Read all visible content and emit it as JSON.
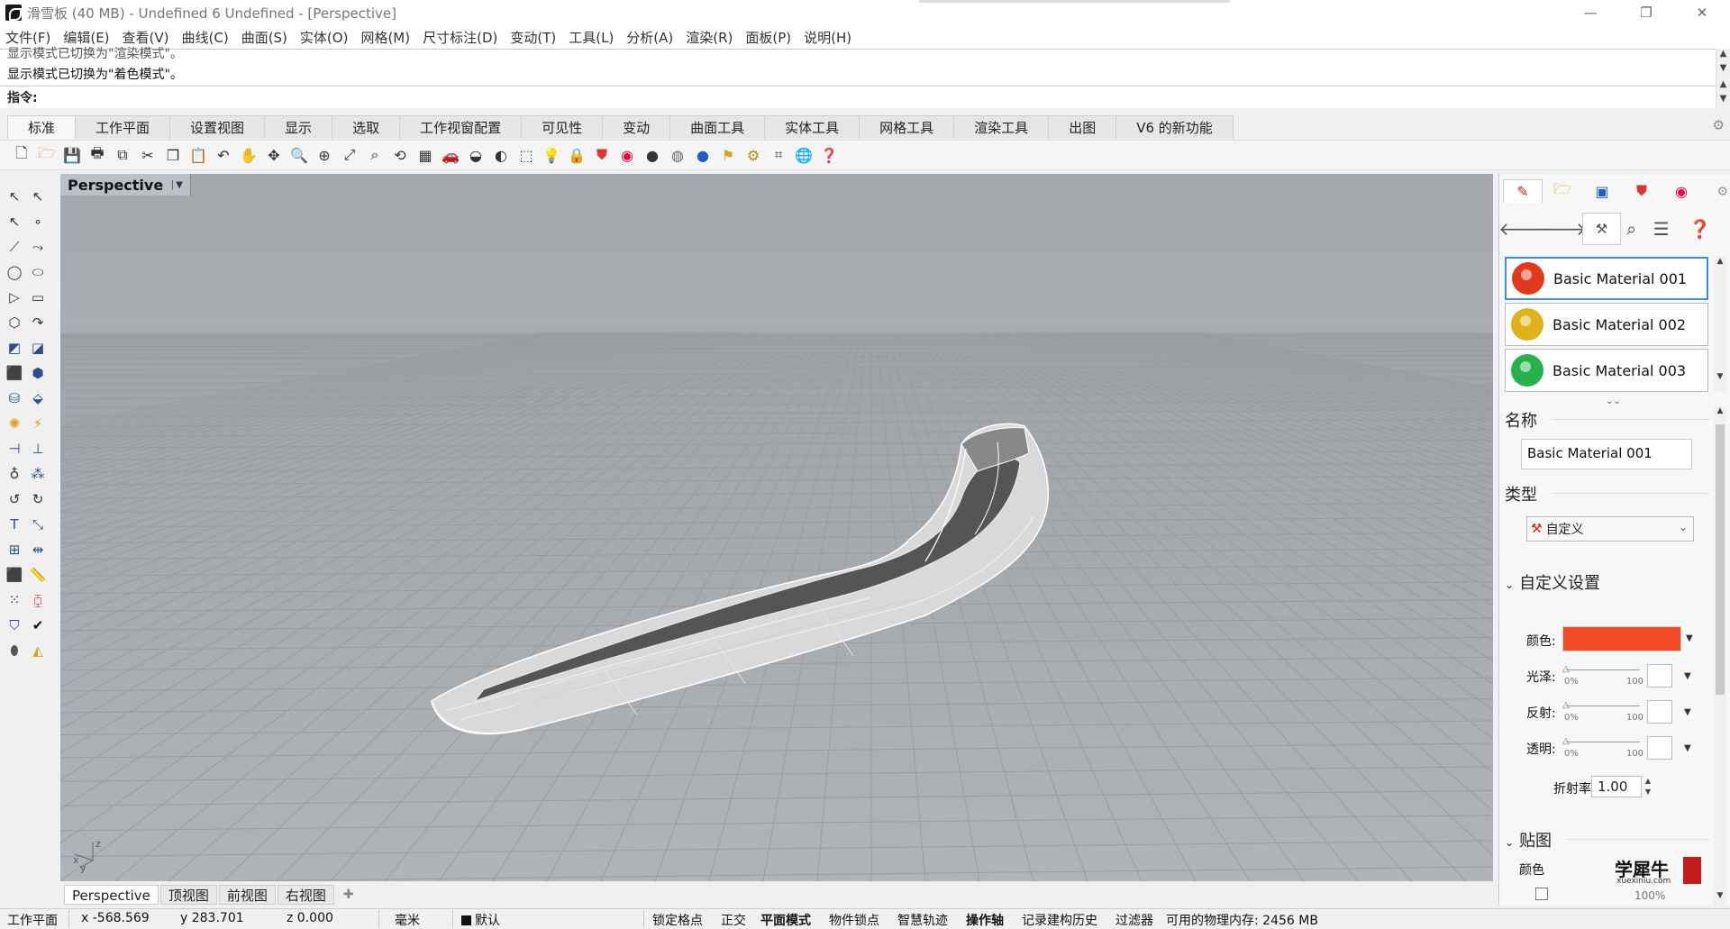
{
  "window": {
    "title": "滑雪板 (40 MB) - Undefined 6 Undefined - [Perspective]",
    "controls": [
      "—",
      "❐",
      "✕"
    ]
  },
  "menu": [
    "文件(F)",
    "编辑(E)",
    "查看(V)",
    "曲线(C)",
    "曲面(S)",
    "实体(O)",
    "网格(M)",
    "尺寸标注(D)",
    "变动(T)",
    "工具(L)",
    "分析(A)",
    "渲染(R)",
    "面板(P)",
    "说明(H)"
  ],
  "command": {
    "history_cut": "显示模式已切换为\"渲染模式\"。",
    "history_last": "显示模式已切换为\"着色模式\"。",
    "prompt": "指令:"
  },
  "tabs": [
    "标准",
    "工作平面",
    "设置视图",
    "显示",
    "选取",
    "工作视窗配置",
    "可见性",
    "变动",
    "曲面工具",
    "实体工具",
    "网格工具",
    "渲染工具",
    "出图",
    "V6 的新功能"
  ],
  "toolbar_icons": [
    "new-file-icon",
    "open-file-icon",
    "save-icon",
    "print-icon",
    "import-icon",
    "cut-icon",
    "copy-icon",
    "paste-icon",
    "undo-icon",
    "pan-icon",
    "rotate-view-icon",
    "zoom-icon",
    "zoom-window-icon",
    "zoom-extents-icon",
    "zoom-selected-icon",
    "rotate-icon",
    "grid-icon",
    "car-icon",
    "hide-icon",
    "show-icon",
    "select-icon",
    "lightbulb-icon",
    "lock-icon",
    "material-icon",
    "color-wheel-icon",
    "sphere-icon",
    "render-sphere-icon",
    "environment-icon",
    "flag-icon",
    "gear-options-icon",
    "transform-icon",
    "globe-icon",
    "help-icon"
  ],
  "viewport": {
    "title": "Perspective",
    "axis_z": "z",
    "axis_x": "x",
    "axis_y": "y"
  },
  "view_tabs": [
    "Perspective",
    "顶视图",
    "前视图",
    "右视图"
  ],
  "status": {
    "cplane": "工作平面",
    "x": "x -568.569",
    "y": "y 283.701",
    "z": "z 0.000",
    "units": "毫米",
    "layer": "默认",
    "grid_snap": "锁定格点",
    "ortho": "正交",
    "planar": "平面模式",
    "osnap": "物件锁点",
    "smarttrack": "智慧轨迹",
    "gumball": "操作轴",
    "history": "记录建构历史",
    "filter": "过滤器",
    "memory": "可用的物理内存: 2456 MB"
  },
  "panel": {
    "materials": [
      {
        "name": "Basic Material 001",
        "color": "#e0391d"
      },
      {
        "name": "Basic Material 002",
        "color": "#e0b21a"
      },
      {
        "name": "Basic Material 003",
        "color": "#25b24a"
      }
    ],
    "name_label": "名称",
    "name_value": "Basic Material 001",
    "type_label": "类型",
    "type_value": "自定义",
    "custom_section": "自定义设置",
    "color_label": "颜色:",
    "color_value": "#f04a26",
    "gloss_label": "光泽:",
    "reflect_label": "反射:",
    "transp_label": "透明:",
    "pct0": "0%",
    "pct100": "100",
    "ior_label": "折射率",
    "ior_value": "1.00",
    "texture_section": "贴图",
    "texture_color": "颜色",
    "texture_pct": "100%",
    "watermark_big": "学犀牛",
    "watermark_small": "xuexiniu.com"
  }
}
